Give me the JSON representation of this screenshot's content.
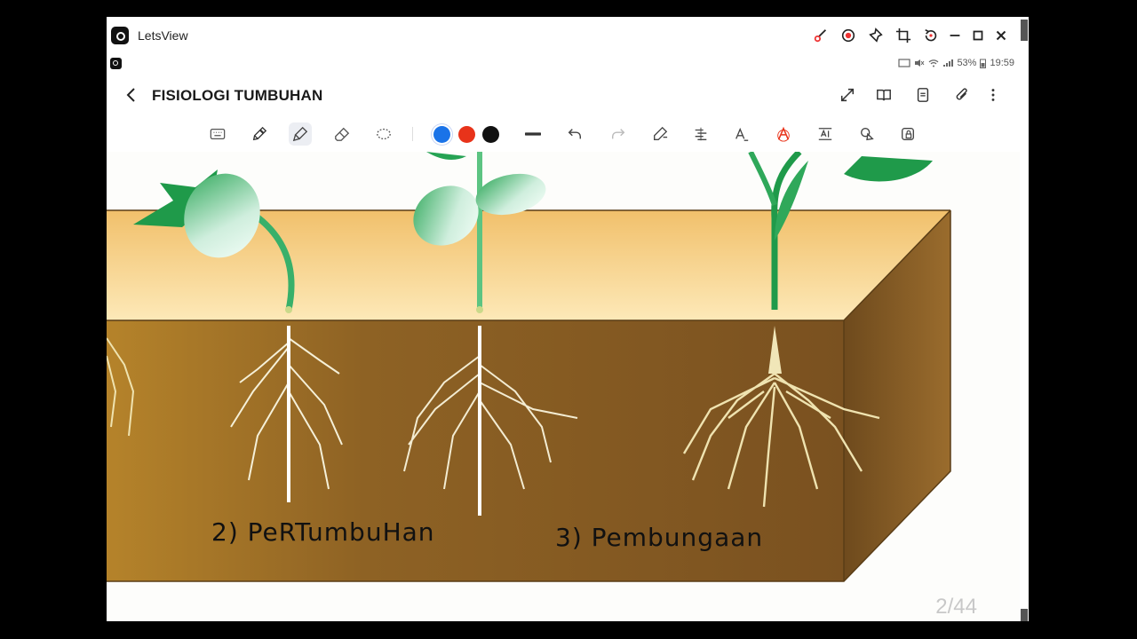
{
  "window": {
    "app_title": "LetsView",
    "controls": [
      "brush-icon",
      "record-icon",
      "pin-icon",
      "crop-icon",
      "rotate-icon",
      "minimize-icon",
      "maximize-icon",
      "close-icon"
    ]
  },
  "statusbar": {
    "battery": "53%",
    "time": "19:59"
  },
  "header": {
    "title": "FISIOLOGI TUMBUHAN"
  },
  "toolbar": {
    "colors": {
      "blue": "#1a73e8",
      "red": "#e8331a",
      "black": "#111111"
    }
  },
  "canvas": {
    "labels": {
      "growth": "2) PeRTumbuHan",
      "flowering": "3) Pembungaan"
    },
    "page_counter": "2/44"
  }
}
